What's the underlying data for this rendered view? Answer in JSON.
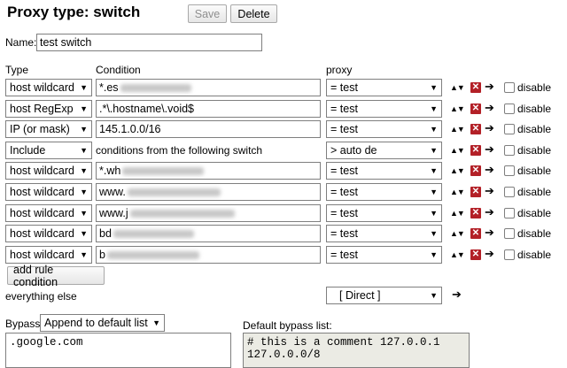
{
  "title": "Proxy type: switch",
  "buttons": {
    "save": "Save",
    "delete": "Delete",
    "add_rule": "add rule condition"
  },
  "name_label": "Name:",
  "name_value": "test switch",
  "headers": {
    "type": "Type",
    "condition": "Condition",
    "proxy": "proxy"
  },
  "rules": [
    {
      "type": "host wildcard",
      "condition": "*.es",
      "condition_blurred": true,
      "proxy": "= test",
      "disable": "disable"
    },
    {
      "type": "host RegExp",
      "condition": ".*\\.hostname\\.void$",
      "condition_blurred": false,
      "proxy": "= test",
      "disable": "disable"
    },
    {
      "type": "IP (or mask)",
      "condition": "145.1.0.0/16",
      "condition_blurred": false,
      "proxy": "= test",
      "disable": "disable"
    },
    {
      "type": "Include",
      "condition": "conditions from the following switch",
      "condition_blurred": false,
      "proxy": "> auto de",
      "disable": "disable",
      "plain_condition": true
    },
    {
      "type": "host wildcard",
      "condition": "*.wh",
      "condition_blurred": true,
      "proxy": "= test",
      "disable": "disable"
    },
    {
      "type": "host wildcard",
      "condition": "www.",
      "condition_blurred": true,
      "proxy": "= test",
      "disable": "disable"
    },
    {
      "type": "host wildcard",
      "condition": "www.j",
      "condition_blurred": true,
      "proxy": "= test",
      "disable": "disable"
    },
    {
      "type": "host wildcard",
      "condition": "bd",
      "condition_blurred": true,
      "proxy": "= test",
      "disable": "disable"
    },
    {
      "type": "host wildcard",
      "condition": "b",
      "condition_blurred": true,
      "proxy": "= test",
      "disable": "disable"
    }
  ],
  "everything_else": {
    "label": "everything else",
    "proxy": "[ Direct ]"
  },
  "bypass": {
    "label": "Bypass:",
    "mode": "Append to default list",
    "custom_text": ".google.com",
    "default_label": "Default bypass list:",
    "default_text": "# this is a comment 127.0.0.1\n127.0.0.0/8"
  },
  "icons": {
    "move": "up-down-arrows-icon",
    "delete": "delete-x-icon",
    "goto": "right-arrow-icon",
    "caret": "dropdown-caret-icon"
  },
  "colors": {
    "delete_icon": "#b32027",
    "readonly_bg": "#ebebe4"
  }
}
